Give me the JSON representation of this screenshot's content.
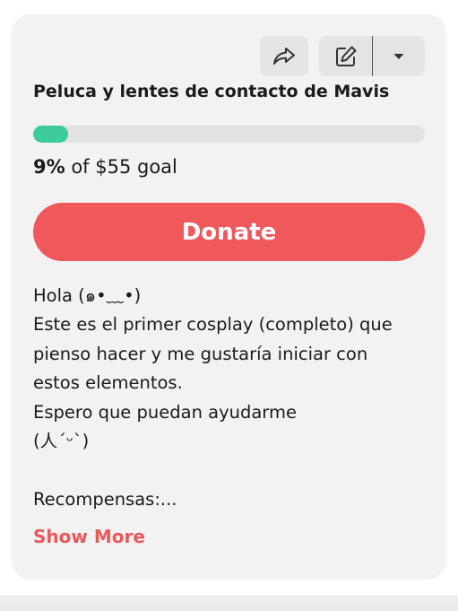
{
  "actions": {
    "share_icon": "share-arrow-icon",
    "edit_icon": "pencil-square-icon",
    "menu_icon": "caret-down-icon"
  },
  "campaign": {
    "title": "Peluca y lentes de contacto de Mavis",
    "progress_fraction": 0.09,
    "progress_percent": "9%",
    "goal_text": " of $55 goal"
  },
  "donate_label": "Donate",
  "description": {
    "lines": [
      "Hola (๑•﹏•)",
      "Este es el primer cosplay (completo) que",
      "pienso hacer y me gustaría iniciar con",
      "estos elementos.",
      "Espero que puedan ayudarme",
      "(人ˊᵕˋ)",
      "",
      "Recompensas:..."
    ]
  },
  "show_more_label": "Show More",
  "colors": {
    "card_bg": "#f2f2f2",
    "progress_fill": "#3ccc9c",
    "donate_bg": "#f0595b",
    "show_more_text": "#e85a5a"
  }
}
